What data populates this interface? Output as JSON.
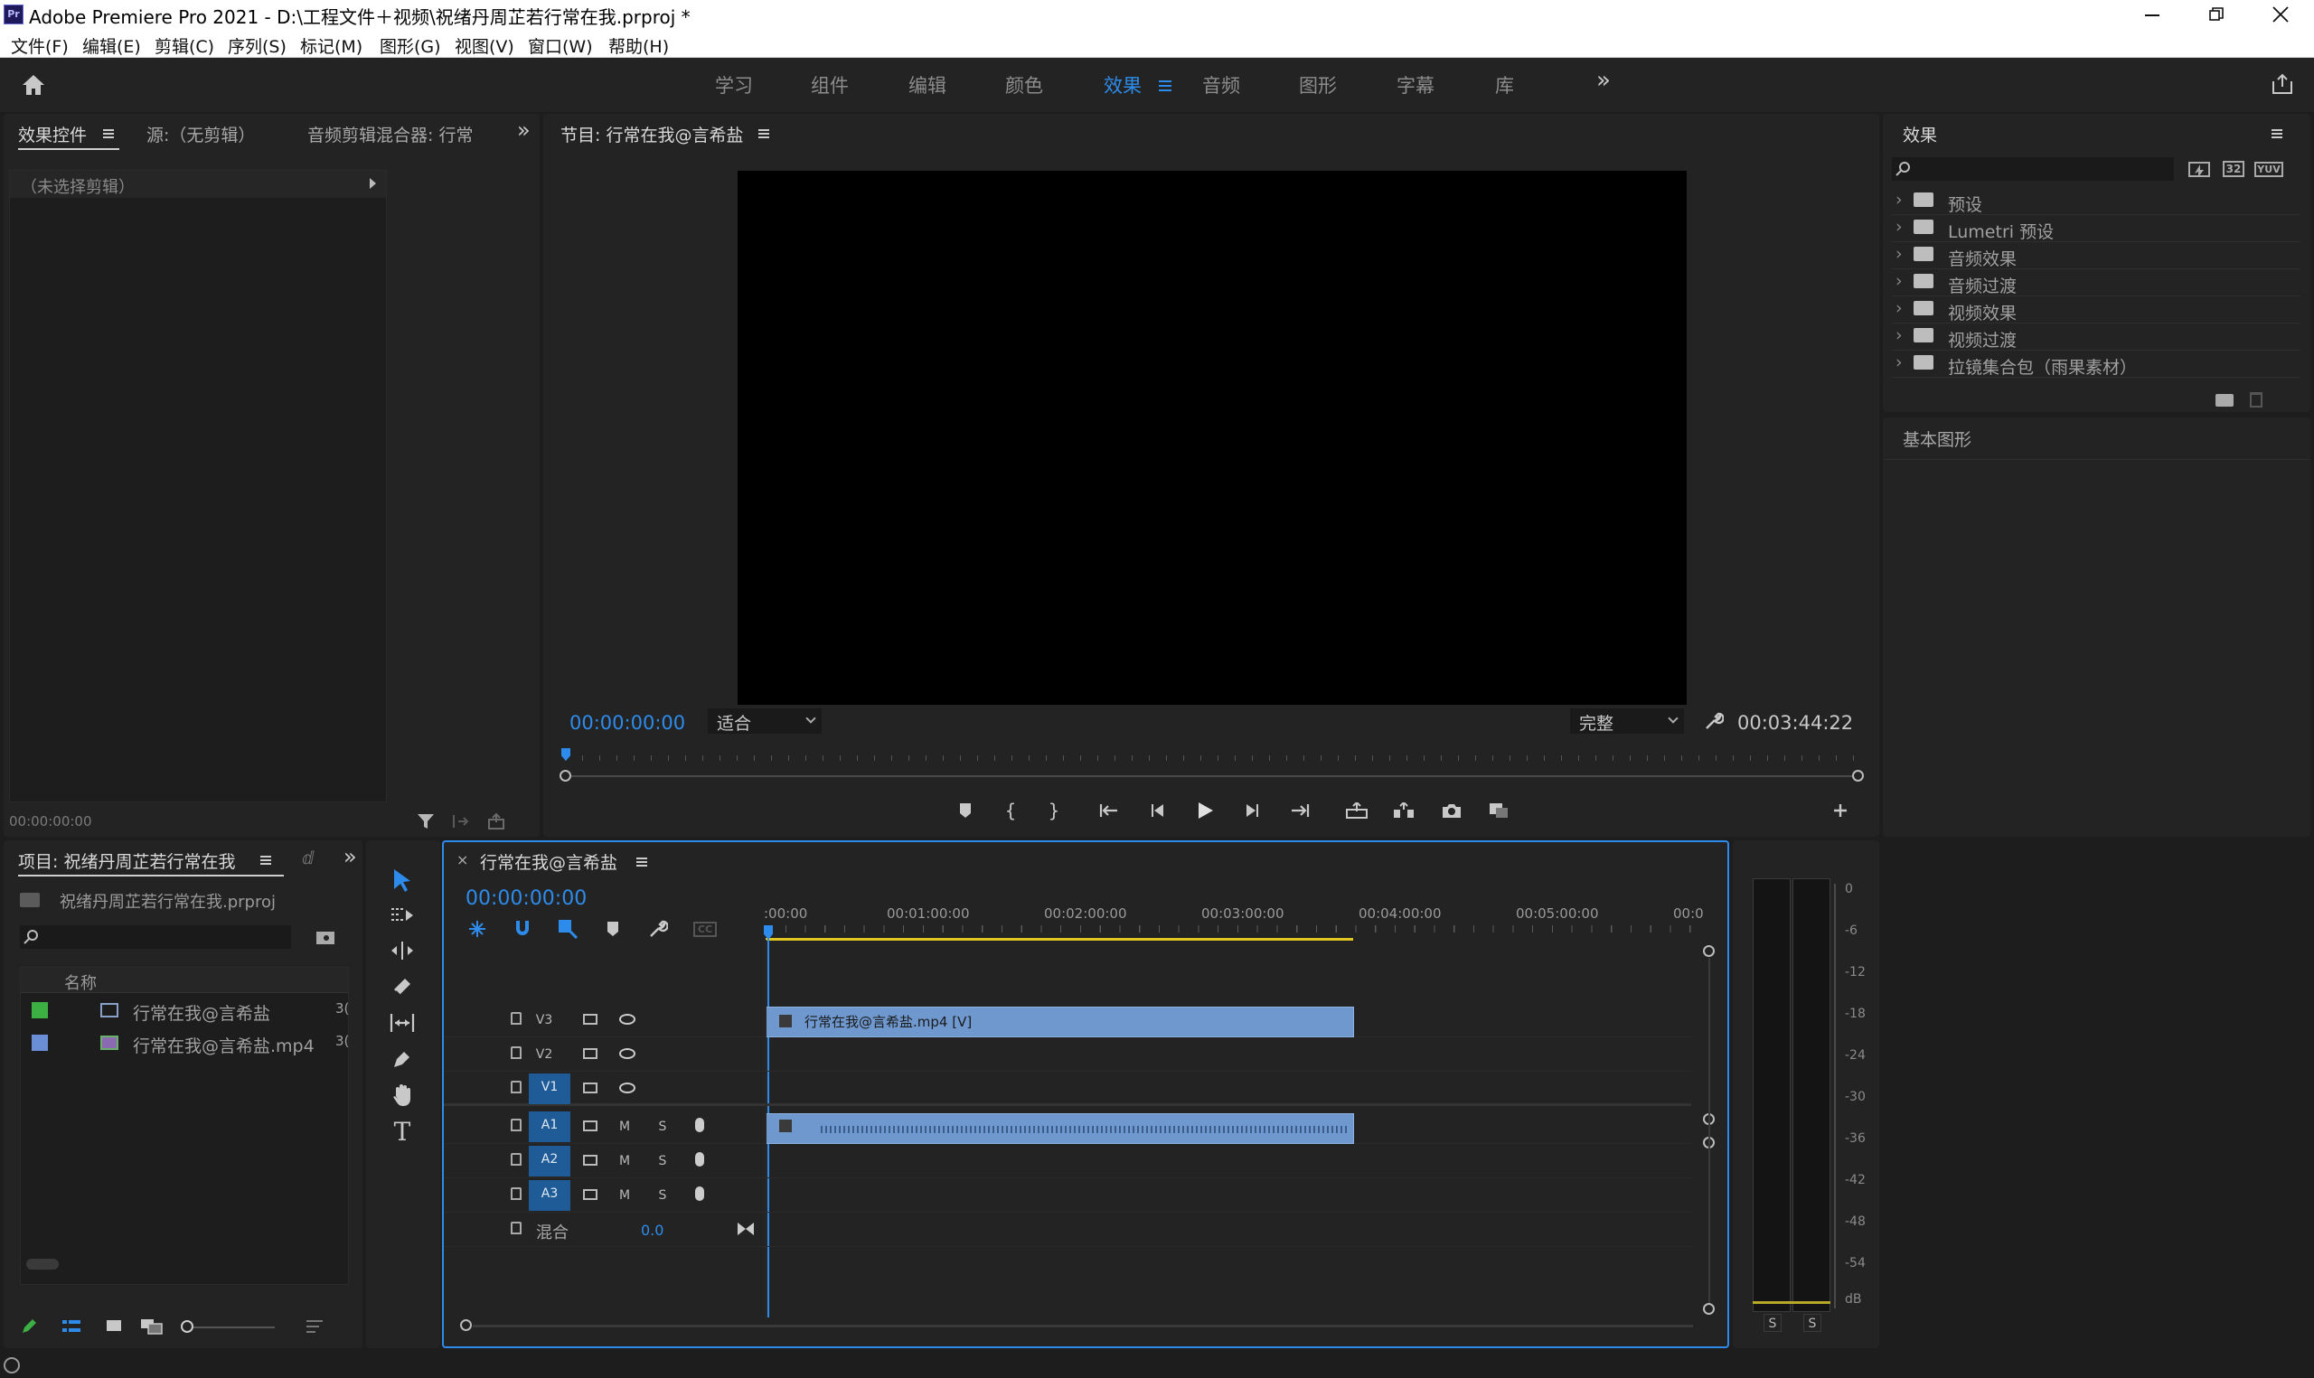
{
  "window": {
    "title": "Adobe Premiere Pro 2021 - D:\\工程文件＋视频\\祝绪丹周芷若行常在我.prproj *",
    "app_badge": "Pr"
  },
  "menu": [
    "文件(F)",
    "编辑(E)",
    "剪辑(C)",
    "序列(S)",
    "标记(M)",
    "图形(G)",
    "视图(V)",
    "窗口(W)",
    "帮助(H)"
  ],
  "workspaces": {
    "items": [
      "学习",
      "组件",
      "编辑",
      "颜色",
      "效果",
      "音频",
      "图形",
      "字幕",
      "库"
    ],
    "active": "效果",
    "more": "»"
  },
  "effect_controls": {
    "tabs": [
      "效果控件",
      "源:（无剪辑）",
      "音频剪辑混合器: 行常"
    ],
    "no_clip": "（未选择剪辑）",
    "timecode": "00:00:00:00"
  },
  "program": {
    "title": "节目: 行常在我@言希盐",
    "timecode": "00:00:00:00",
    "fit": "适合",
    "quality": "完整",
    "duration": "00:03:44:22",
    "playhead_frac": 0
  },
  "project": {
    "title": "项目: 祝绪丹周芷若行常在我",
    "file": "祝绪丹周芷若行常在我.prproj",
    "column": "名称",
    "items": [
      {
        "name": "行常在我@言希盐",
        "color": "#3cb043",
        "tail": "3("
      },
      {
        "name": "行常在我@言希盐.mp4",
        "color": "#6b8fd6",
        "tail": "3("
      }
    ]
  },
  "timeline": {
    "title": "行常在我@言希盐",
    "timecode": "00:00:00:00",
    "ruler": [
      ":00:00",
      "00:01:00:00",
      "00:02:00:00",
      "00:03:00:00",
      "00:04:00:00",
      "00:05:00:00",
      "00:0"
    ],
    "video_tracks": [
      "V3",
      "V2",
      "V1"
    ],
    "audio_tracks": [
      "A1",
      "A2",
      "A3"
    ],
    "m": "M",
    "s": "S",
    "mix": "混合",
    "mix_val": "0.0",
    "clip_video": "行常在我@言希盐.mp4 [V]"
  },
  "effects": {
    "title": "效果",
    "items": [
      "预设",
      "Lumetri 预设",
      "音频效果",
      "音频过渡",
      "视频效果",
      "视频过渡",
      "拉镜集合包（雨果素材）"
    ],
    "badge32": "32",
    "badgeYUV": "YUV"
  },
  "essential_graphics": {
    "title": "基本图形"
  },
  "meter": {
    "scale": [
      "0",
      "-6",
      "-12",
      "-18",
      "-24",
      "-30",
      "-36",
      "-42",
      "-48",
      "-54",
      "dB"
    ],
    "solo": [
      "S",
      "S"
    ]
  },
  "colors": {
    "accent": "#2d8ceb",
    "clip": "#6f98cf",
    "workarea": "#e2c622"
  }
}
